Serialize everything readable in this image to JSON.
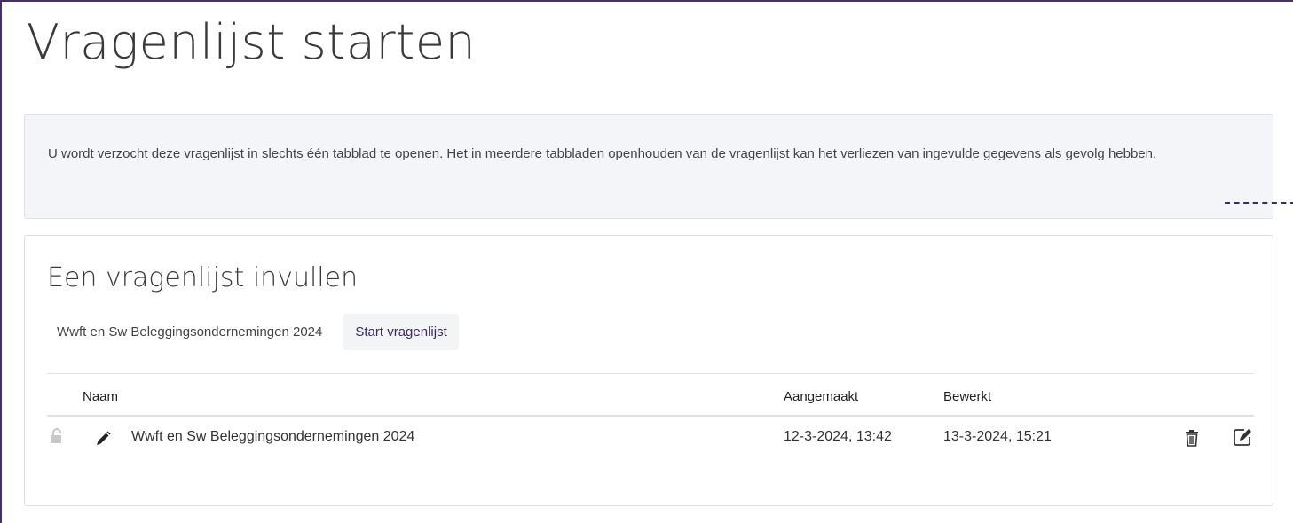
{
  "page": {
    "title": "Vragenlijst starten",
    "notice": "U wordt verzocht deze vragenlijst in slechts één tabblad te openen. Het in meerdere tabbladen openhouden van de vragenlijst kan het verliezen van ingevulde gegevens als gevolg hebben."
  },
  "panel": {
    "title": "Een vragenlijst invullen",
    "selected_questionnaire": "Wwft en Sw Beleggingsondernemingen 2024",
    "start_button_label": "Start vragenlijst"
  },
  "table": {
    "columns": {
      "name": "Naam",
      "created": "Aangemaakt",
      "edited": "Bewerkt"
    },
    "rows": [
      {
        "name": "Wwft en Sw Beleggingsondernemingen 2024",
        "created": "12-3-2024, 13:42",
        "edited": "13-3-2024, 15:21",
        "status_icon": "unlocked-icon"
      }
    ]
  },
  "colors": {
    "accent": "#3b2a5e",
    "frame": "#4a2d6b",
    "alert_bg": "#f3f5f8"
  }
}
